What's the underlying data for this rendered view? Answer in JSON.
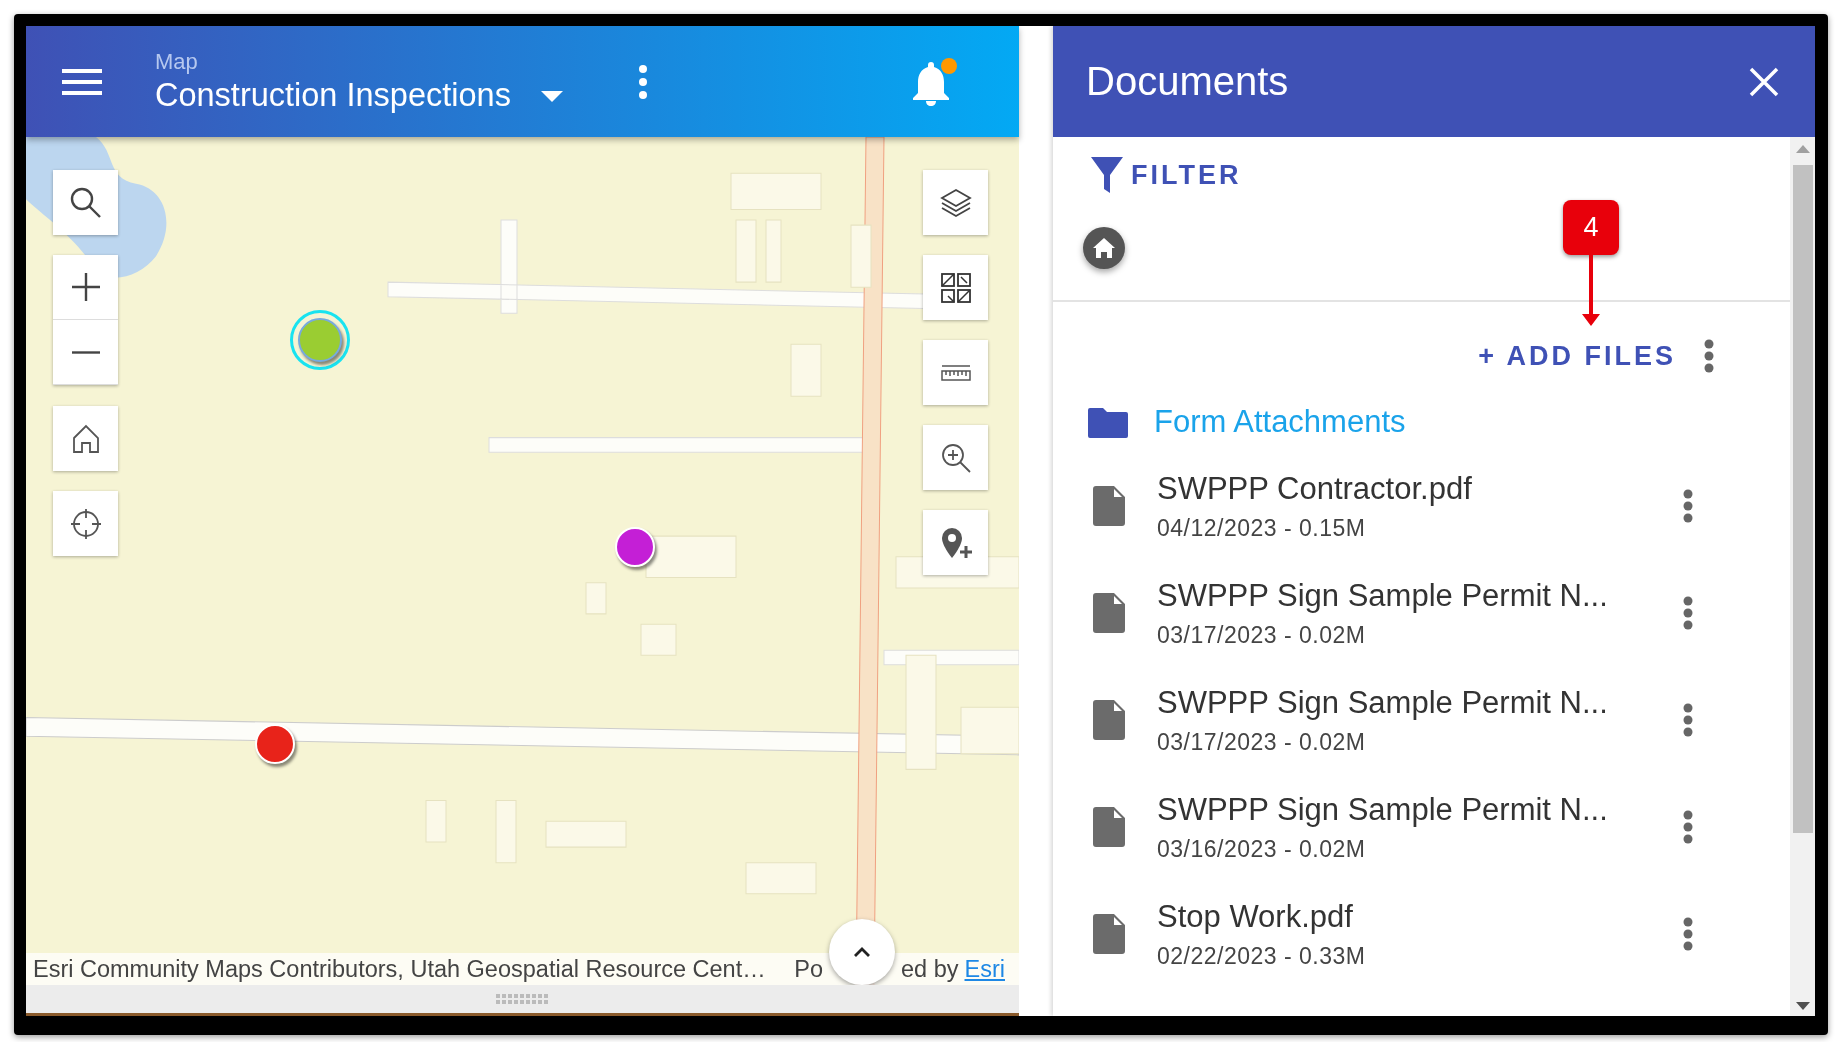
{
  "map_header": {
    "subtitle": "Map",
    "title": "Construction Inspections",
    "notifications_unread": true
  },
  "map": {
    "kind": "picture",
    "markers": [
      {
        "color": "#9acd32",
        "selected": true
      },
      {
        "color": "#c41fd6",
        "selected": false
      },
      {
        "color": "#e8231a",
        "selected": false
      }
    ],
    "attribution": {
      "sources": "Esri Community Maps Contributors, Utah Geospatial Resource Cent…",
      "powered_start": "Po",
      "powered_end": "ed by",
      "link": "Esri"
    }
  },
  "documents": {
    "title": "Documents",
    "filter": "FILTER",
    "callout": "4",
    "add_files": "+ ADD FILES",
    "folder": "Form Attachments",
    "files": [
      {
        "name": "SWPPP Contractor.pdf",
        "details": "04/12/2023 - 0.15M"
      },
      {
        "name": "SWPPP Sign Sample Permit N...",
        "details": "03/17/2023 - 0.02M"
      },
      {
        "name": "SWPPP Sign Sample Permit N...",
        "details": "03/17/2023 - 0.02M"
      },
      {
        "name": "SWPPP Sign Sample Permit N...",
        "details": "03/16/2023 - 0.02M"
      },
      {
        "name": "Stop Work.pdf",
        "details": "02/22/2023 - 0.33M"
      }
    ]
  }
}
